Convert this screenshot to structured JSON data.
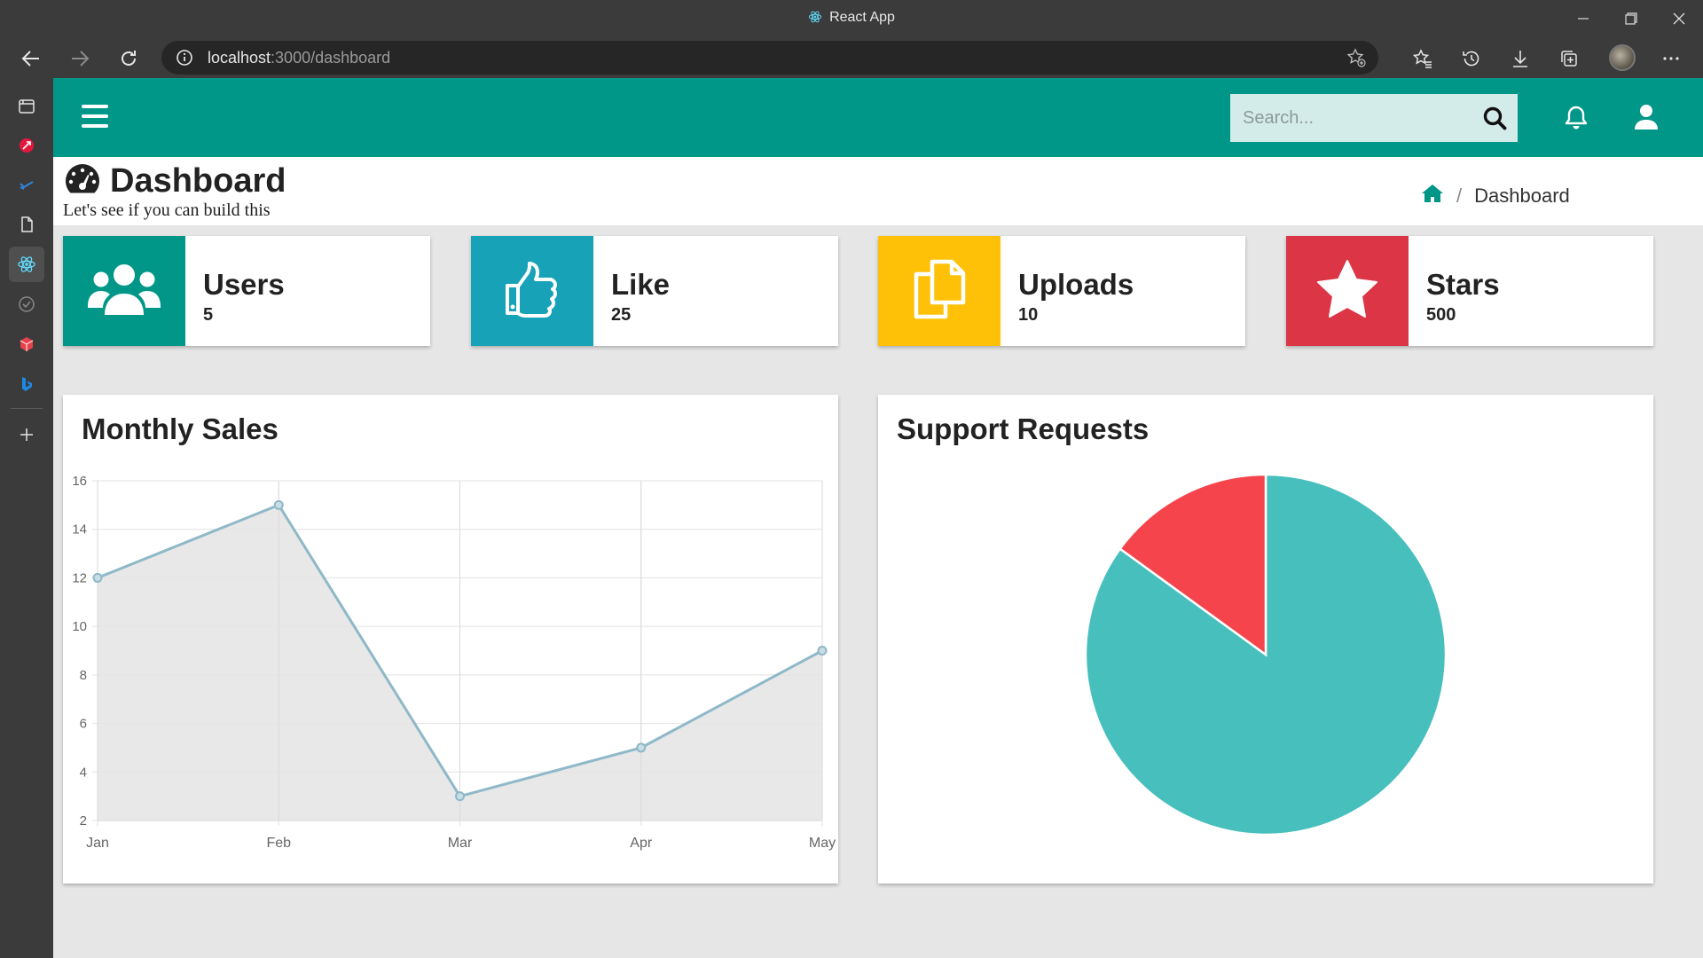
{
  "browser": {
    "tab_title": "React App",
    "url_host": "localhost",
    "url_path": ":3000/dashboard"
  },
  "app": {
    "search_placeholder": "Search...",
    "page_title": "Dashboard",
    "subtitle": "Let's see if you can build this",
    "breadcrumb": {
      "current": "Dashboard"
    },
    "colors": {
      "appbar": "#009688",
      "users": "#009688",
      "like": "#17a2b8",
      "uploads": "#ffc107",
      "stars": "#dc3545"
    }
  },
  "cards": [
    {
      "label": "Users",
      "value": "5",
      "icon": "users-icon"
    },
    {
      "label": "Like",
      "value": "25",
      "icon": "thumbs-up-icon"
    },
    {
      "label": "Uploads",
      "value": "10",
      "icon": "copy-icon"
    },
    {
      "label": "Stars",
      "value": "500",
      "icon": "star-icon"
    }
  ],
  "panels": {
    "sales_title": "Monthly Sales",
    "support_title": "Support Requests"
  },
  "chart_data": [
    {
      "type": "line",
      "title": "Monthly Sales",
      "categories": [
        "Jan",
        "Feb",
        "Mar",
        "Apr",
        "May"
      ],
      "values": [
        12,
        15,
        3,
        5,
        9
      ],
      "ylim": [
        2,
        16
      ],
      "yticks": [
        2,
        4,
        6,
        8,
        10,
        12,
        14,
        16
      ],
      "fill": true,
      "grid": true,
      "line_color": "#8fb8c8",
      "fill_color": "#e4e4e4"
    },
    {
      "type": "pie",
      "title": "Support Requests",
      "values": [
        85,
        15
      ],
      "colors": [
        "#47bfbd",
        "#f5444c"
      ]
    }
  ]
}
